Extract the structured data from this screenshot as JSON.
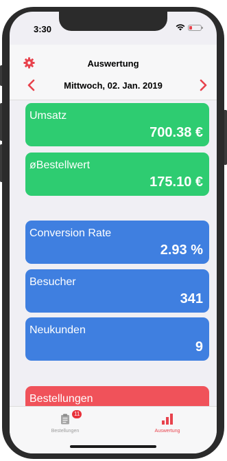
{
  "status_bar": {
    "time": "3:30"
  },
  "nav": {
    "title": "Auswertung",
    "date": "Mittwoch, 02. Jan. 2019"
  },
  "cards": [
    {
      "label": "Umsatz",
      "value": "700.38 €"
    },
    {
      "label": "øBestellwert",
      "value": "175.10 €"
    },
    {
      "label": "Conversion Rate",
      "value": "2.93 %"
    },
    {
      "label": "Besucher",
      "value": "341"
    },
    {
      "label": "Neukunden",
      "value": "9"
    },
    {
      "label": "Bestellungen",
      "value": ""
    }
  ],
  "tabbar": {
    "tabs": [
      {
        "label": "Bestellungen",
        "badge": "11",
        "icon": "clipboard-icon"
      },
      {
        "label": "Auswertung",
        "icon": "bar-chart-icon"
      }
    ]
  },
  "colors": {
    "accent": "#e8434d",
    "green": "#2ecc71",
    "blue": "#3f7fe0",
    "red": "#f0525a",
    "inactive": "#9a9a9a"
  }
}
